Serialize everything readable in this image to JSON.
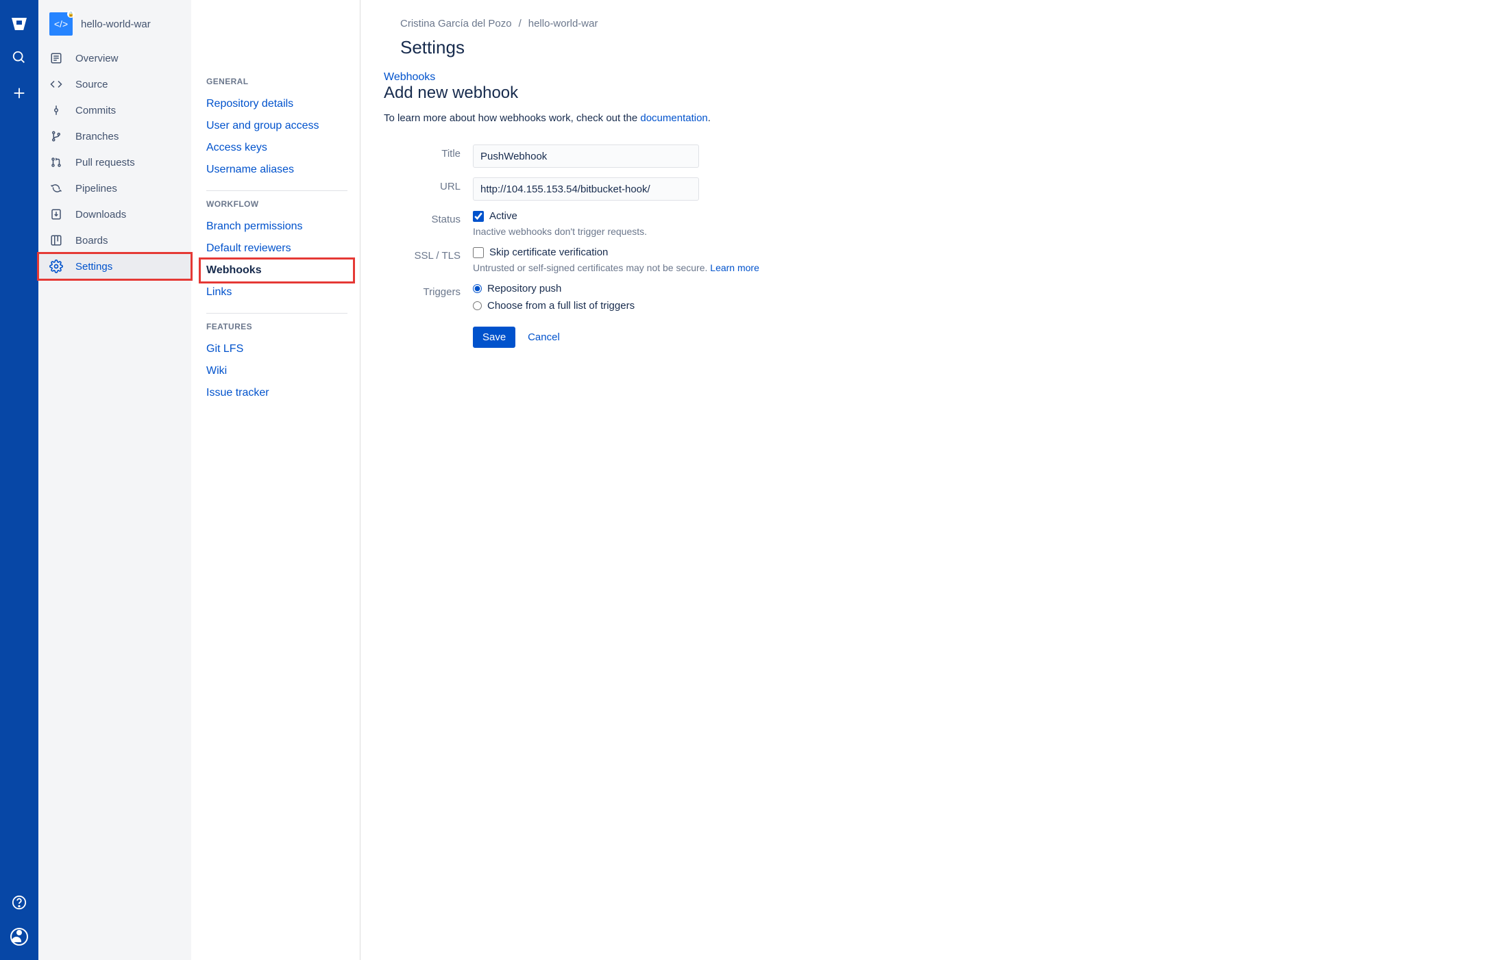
{
  "rail": {
    "product": "Bitbucket"
  },
  "repo": {
    "name": "hello-world-war"
  },
  "breadcrumb": {
    "owner": "Cristina García del Pozo",
    "repo": "hello-world-war"
  },
  "page": {
    "title": "Settings"
  },
  "sidebar": {
    "items": [
      {
        "label": "Overview"
      },
      {
        "label": "Source"
      },
      {
        "label": "Commits"
      },
      {
        "label": "Branches"
      },
      {
        "label": "Pull requests"
      },
      {
        "label": "Pipelines"
      },
      {
        "label": "Downloads"
      },
      {
        "label": "Boards"
      },
      {
        "label": "Settings"
      }
    ]
  },
  "settings_nav": {
    "general_heading": "General",
    "general": [
      "Repository details",
      "User and group access",
      "Access keys",
      "Username aliases"
    ],
    "workflow_heading": "Workflow",
    "workflow": [
      "Branch permissions",
      "Default reviewers",
      "Webhooks",
      "Links"
    ],
    "features_heading": "Features",
    "features": [
      "Git LFS",
      "Wiki",
      "Issue tracker"
    ]
  },
  "form": {
    "section_link": "Webhooks",
    "heading": "Add new webhook",
    "lead_prefix": "To learn more about how webhooks work, check out the ",
    "lead_link": "documentation",
    "lead_suffix": ".",
    "title_label": "Title",
    "title_value": "PushWebhook",
    "url_label": "URL",
    "url_value": "http://104.155.153.54/bitbucket-hook/",
    "status_label": "Status",
    "status_value": "Active",
    "status_helper": "Inactive webhooks don't trigger requests.",
    "ssl_label": "SSL / TLS",
    "ssl_value": "Skip certificate verification",
    "ssl_helper": "Untrusted or self-signed certificates may not be secure. ",
    "ssl_helper_link": "Learn more",
    "triggers_label": "Triggers",
    "trigger_push": "Repository push",
    "trigger_full": "Choose from a full list of triggers",
    "save": "Save",
    "cancel": "Cancel"
  }
}
